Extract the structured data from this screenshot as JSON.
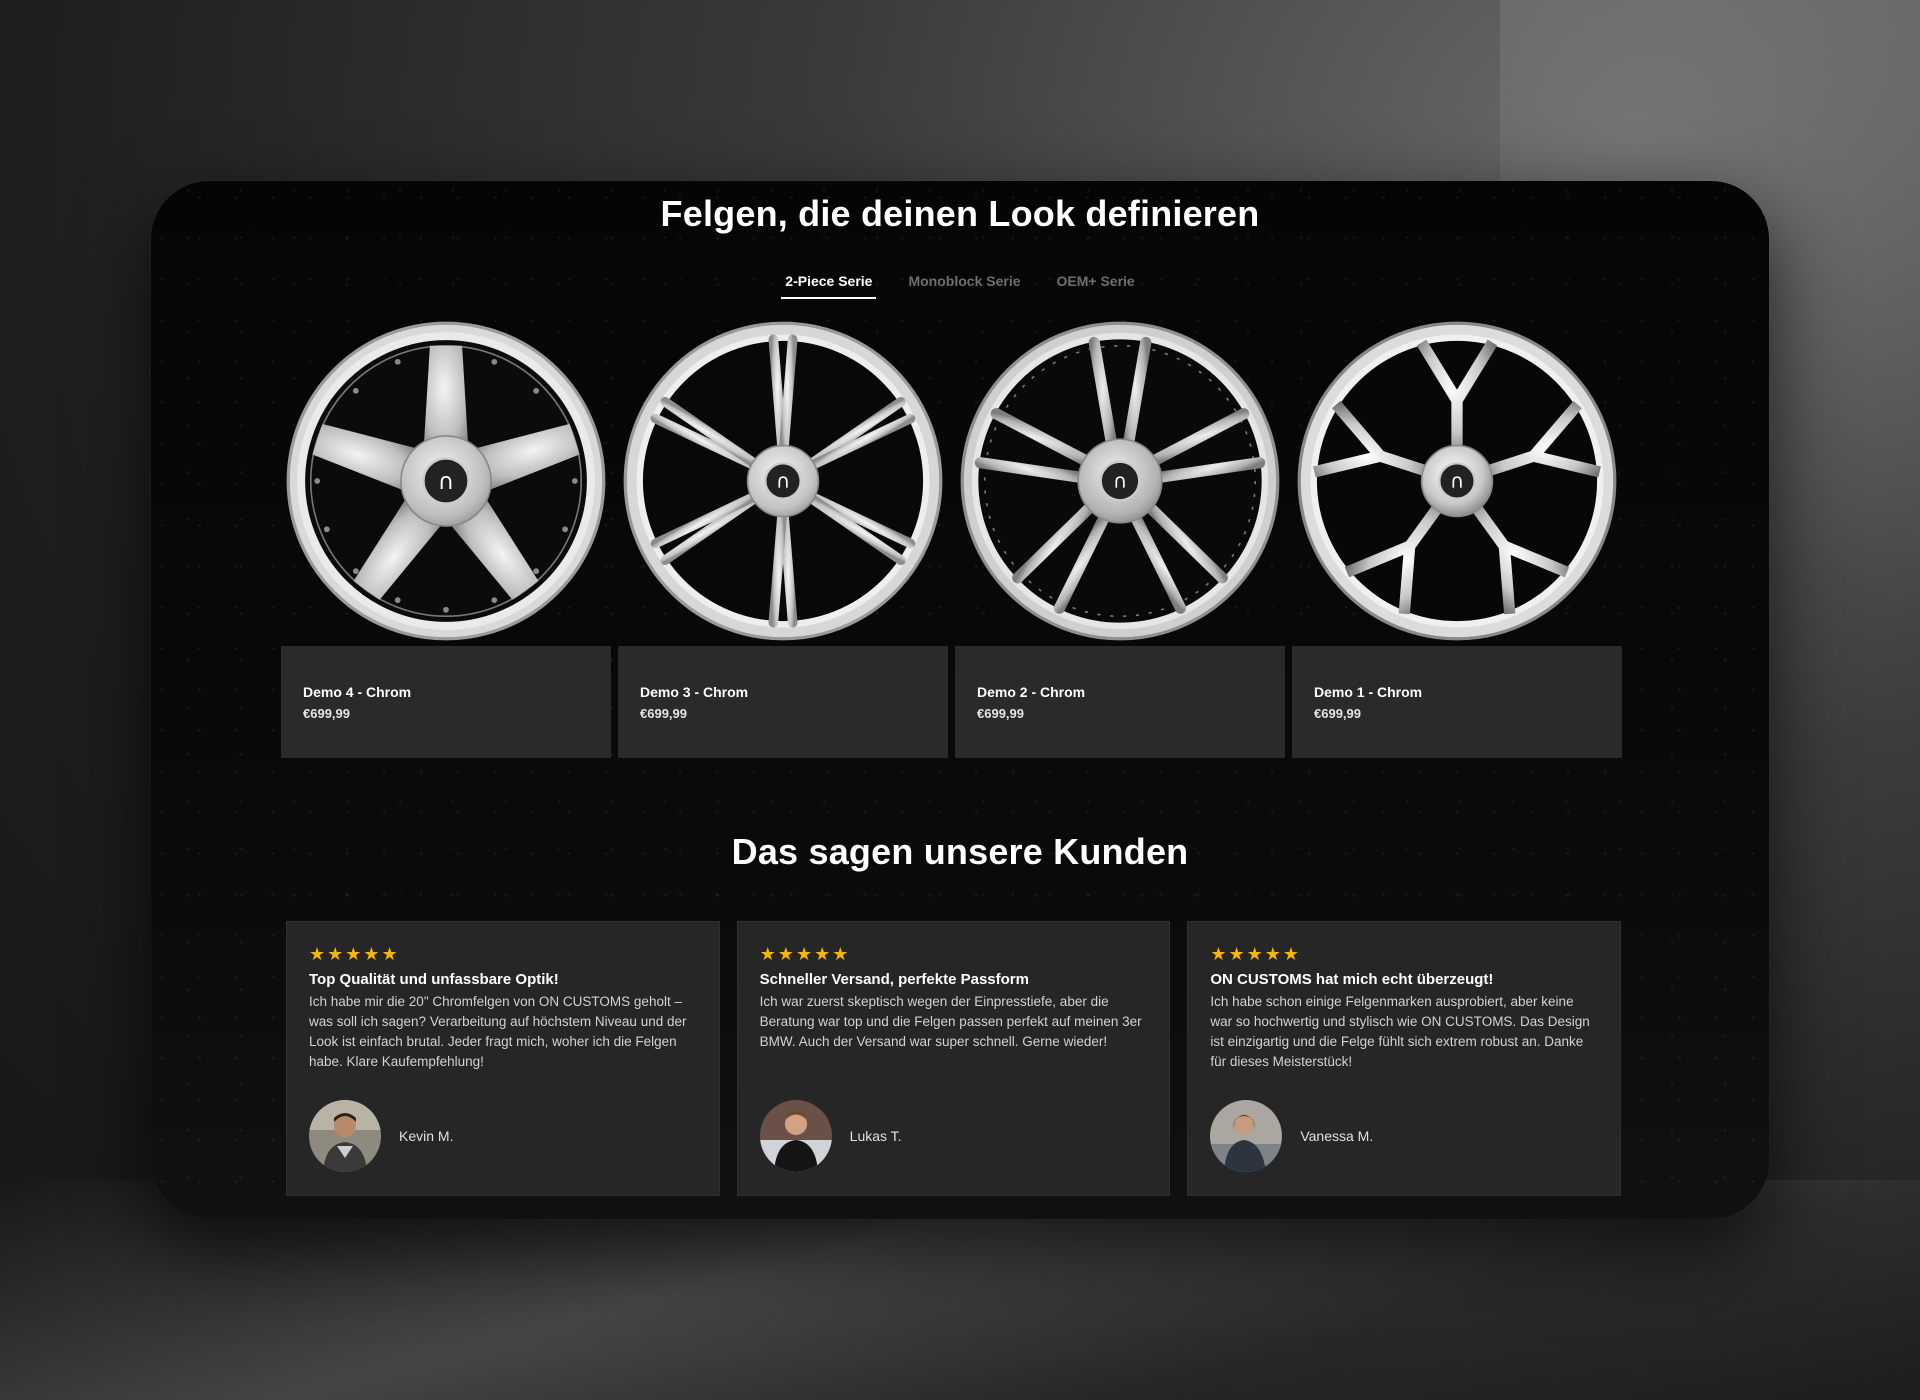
{
  "section1": {
    "title": "Felgen, die deinen Look definieren",
    "tabs": [
      {
        "label": "2-Piece Serie",
        "active": true
      },
      {
        "label": "Monoblock Serie",
        "active": false
      },
      {
        "label": "OEM+ Serie",
        "active": false
      }
    ]
  },
  "products": [
    {
      "name": "Demo 4 - Chrom",
      "price": "€699,99"
    },
    {
      "name": "Demo 3 - Chrom",
      "price": "€699,99"
    },
    {
      "name": "Demo 2 - Chrom",
      "price": "€699,99"
    },
    {
      "name": "Demo 1 - Chrom",
      "price": "€699,99"
    }
  ],
  "section2": {
    "title": "Das sagen unsere Kunden"
  },
  "reviews": [
    {
      "stars": "★★★★★",
      "title": "Top Qualität und unfassbare Optik!",
      "text": "Ich habe mir die 20\" Chromfelgen von ON CUSTOMS geholt – was soll ich sagen? Verarbeitung auf höchstem Niveau und der Look ist einfach brutal. Jeder fragt mich, woher ich die Felgen habe. Klare Kaufempfehlung!",
      "author": "Kevin M."
    },
    {
      "stars": "★★★★★",
      "title": "Schneller Versand, perfekte Passform",
      "text": "Ich war zuerst skeptisch wegen der Einpresstiefe, aber die Beratung war top und die Felgen passen perfekt auf meinen 3er BMW. Auch der Versand war super schnell. Gerne wieder!",
      "author": "Lukas T."
    },
    {
      "stars": "★★★★★",
      "title": "ON CUSTOMS hat mich echt überzeugt!",
      "text": "Ich habe schon einige Felgenmarken ausprobiert, aber keine war so hochwertig und stylisch wie ON CUSTOMS. Das Design ist einzigartig und die Felge fühlt sich extrem robust an. Danke für dieses Meisterstück!",
      "author": "Vanessa M."
    }
  ],
  "colors": {
    "star": "#f5b50a",
    "card_bg": "#2a2a2a",
    "panel_bg": "#070707"
  },
  "icons": {
    "star": "star-icon",
    "wheel": "rim-image",
    "avatar": "avatar-photo"
  }
}
